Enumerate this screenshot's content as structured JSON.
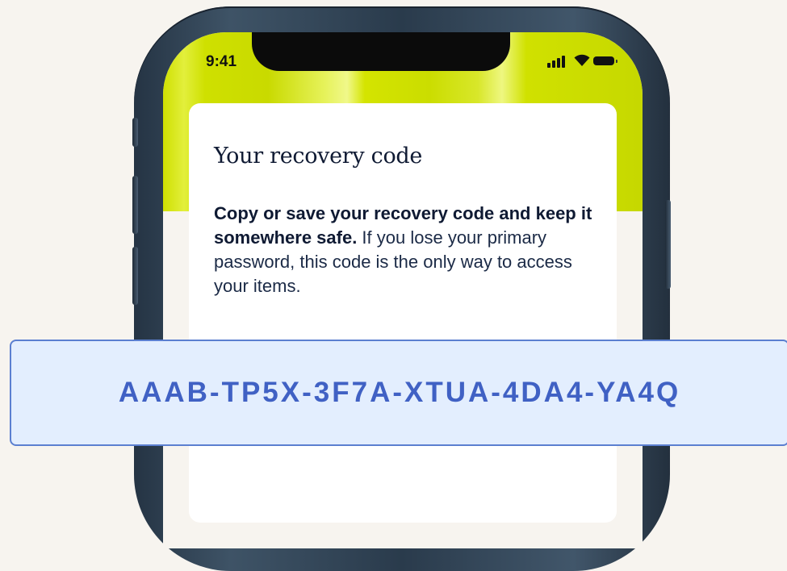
{
  "status_bar": {
    "time": "9:41",
    "signal_icon": "cellular-signal-icon",
    "wifi_icon": "wifi-icon",
    "battery_icon": "battery-icon"
  },
  "card": {
    "title": "Your recovery code",
    "body_bold": "Copy or save your recovery code and keep it somewhere safe.",
    "body_regular": " If you lose your primary password, this code is the only way to access your items."
  },
  "recovery_code": {
    "value": "AAAB-TP5X-3F7A-XTUA-4DA4-YA4Q"
  },
  "colors": {
    "accent_yellow": "#CFE000",
    "code_background": "#E3EEFE",
    "code_border": "#5B7FD0",
    "code_text": "#4061C4",
    "page_background": "#F7F4EF"
  }
}
